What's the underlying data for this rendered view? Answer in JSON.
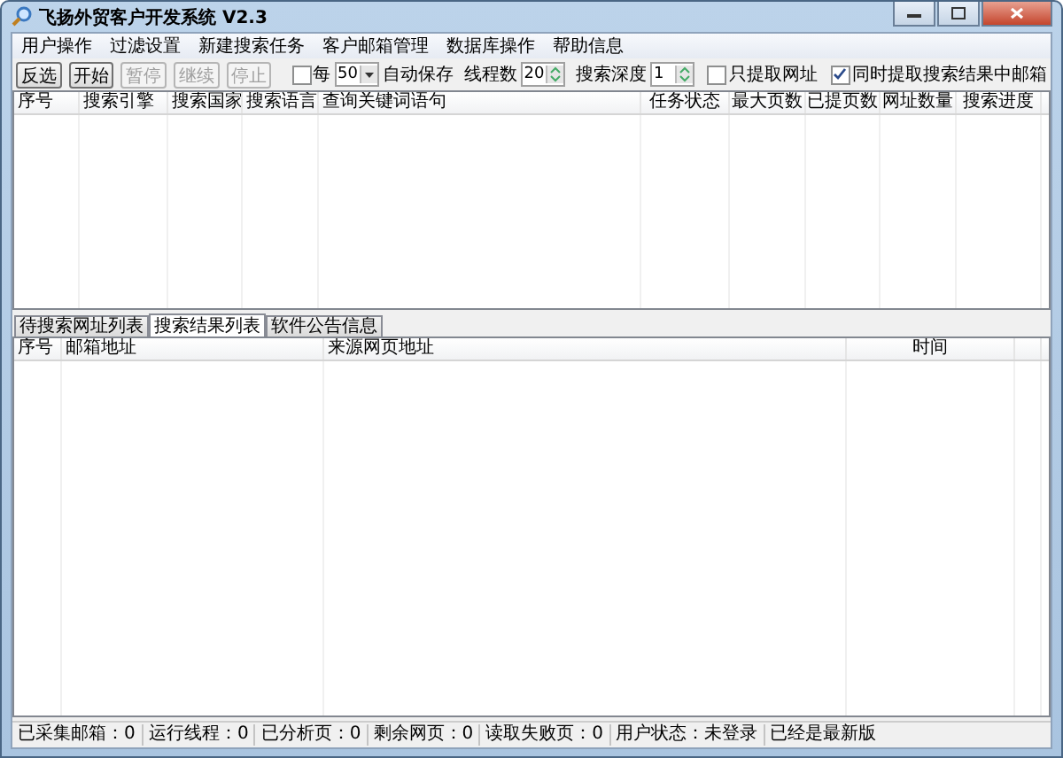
{
  "window": {
    "title": "飞扬外贸客户开发系统 V2.3"
  },
  "menu": [
    "用户操作",
    "过滤设置",
    "新建搜索任务",
    "客户邮箱管理",
    "数据库操作",
    "帮助信息"
  ],
  "toolbar": {
    "buttons": [
      {
        "label": "反选",
        "disabled": false
      },
      {
        "label": "开始",
        "disabled": false
      },
      {
        "label": "暂停",
        "disabled": true
      },
      {
        "label": "继续",
        "disabled": true
      },
      {
        "label": "停止",
        "disabled": true
      }
    ],
    "autosave": {
      "prefix": "每",
      "checked": false,
      "value": "50",
      "suffix": "自动保存"
    },
    "threads": {
      "label": "线程数",
      "value": "20"
    },
    "depth": {
      "label": "搜索深度",
      "value": "1"
    },
    "options": [
      {
        "label": "只提取网址",
        "checked": false
      },
      {
        "label": "同时提取搜索结果中邮箱",
        "checked": true
      }
    ]
  },
  "task_table": {
    "columns": [
      "序号",
      "搜索引擎",
      "搜索国家",
      "搜索语言",
      "查询关键词语句",
      "任务状态",
      "最大页数",
      "已提页数",
      "网址数量",
      "搜索进度"
    ]
  },
  "tabs": [
    {
      "label": "待搜索网址列表",
      "selected": false
    },
    {
      "label": "搜索结果列表",
      "selected": true
    },
    {
      "label": "软件公告信息",
      "selected": false
    }
  ],
  "result_table": {
    "columns": [
      "序号",
      "邮箱地址",
      "来源网页地址",
      "时间",
      ""
    ]
  },
  "status_bar": [
    "已采集邮箱：0",
    "运行线程：0",
    "已分析页：0",
    "剩余网页：0",
    "读取失败页：0",
    "用户状态：未登录",
    "已经是最新版"
  ]
}
